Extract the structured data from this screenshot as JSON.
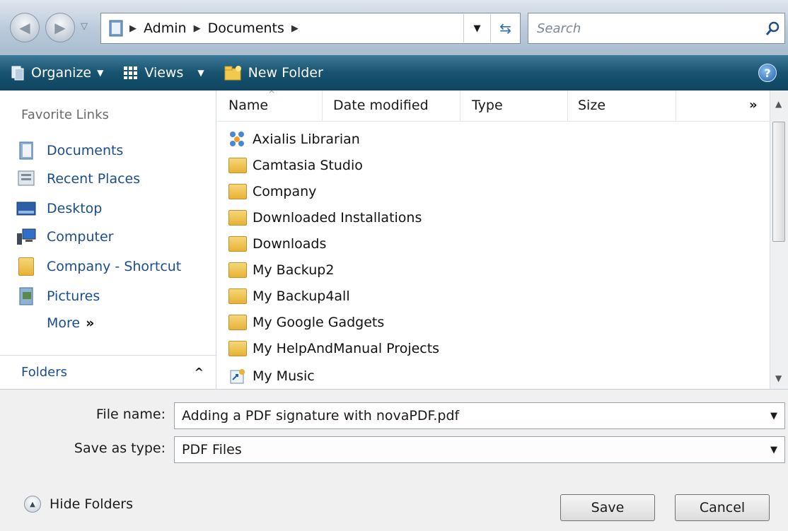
{
  "address": {
    "crumbs": [
      "Admin",
      "Documents"
    ],
    "search_placeholder": "Search"
  },
  "toolbar": {
    "organize": "Organize",
    "views": "Views",
    "new_folder": "New Folder"
  },
  "sidebar": {
    "heading": "Favorite Links",
    "links": [
      "Documents",
      "Recent Places",
      "Desktop",
      "Computer",
      "Company - Shortcut",
      "Pictures"
    ],
    "more": "More",
    "folders": "Folders"
  },
  "columns": [
    "Name",
    "Date modified",
    "Type",
    "Size"
  ],
  "files": [
    "Axialis Librarian",
    "Camtasia Studio",
    "Company",
    "Downloaded Installations",
    "Downloads",
    "My Backup2",
    "My Backup4all",
    "My Google Gadgets",
    "My HelpAndManual Projects",
    "My Music"
  ],
  "form": {
    "file_name_label": "File name:",
    "file_name_value": "Adding a PDF signature with novaPDF.pdf",
    "type_label": "Save as type:",
    "type_value": "PDF Files"
  },
  "buttons": {
    "hide_folders": "Hide Folders",
    "save": "Save",
    "cancel": "Cancel"
  }
}
